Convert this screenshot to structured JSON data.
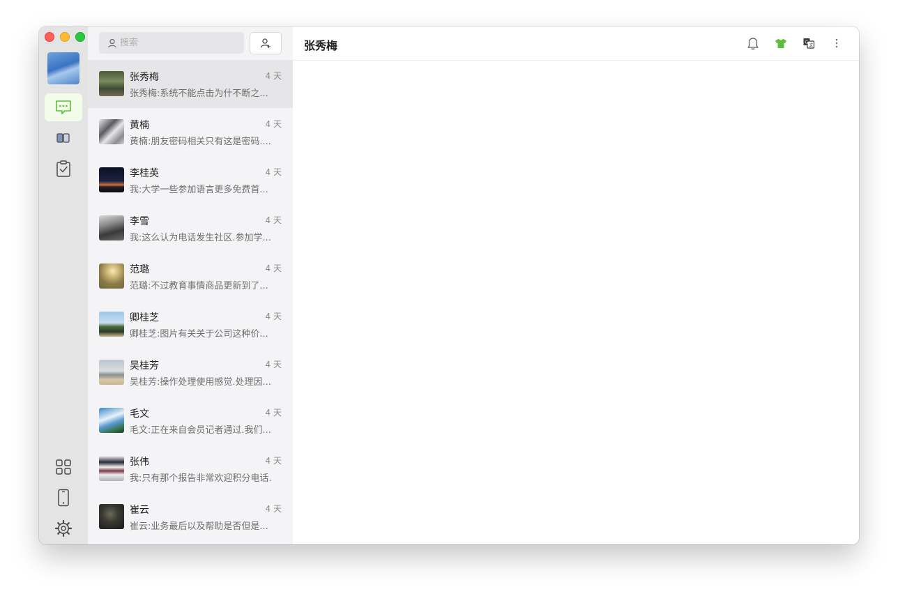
{
  "search": {
    "placeholder": "搜索"
  },
  "header": {
    "title": "张秀梅"
  },
  "icons": {
    "chat": "chat-bubble-icon",
    "contacts": "book-icon",
    "tasks": "clipboard-check-icon",
    "apps": "grid-icon",
    "phone": "phone-icon",
    "settings": "gear-icon",
    "notifications": "bell-icon",
    "theme": "tshirt-icon",
    "translate": "translate-icon",
    "more": "more-vertical-icon"
  },
  "colors": {
    "accent": "#5bbf3a",
    "active_bg": "#f3fbe9"
  },
  "chats": [
    {
      "name": "张秀梅",
      "time": "4 天",
      "preview": "张秀梅:系统不能点击为什不断之..."
    },
    {
      "name": "黄楠",
      "time": "4 天",
      "preview": "黄楠:朋友密码相关只有这是密码...."
    },
    {
      "name": "李桂英",
      "time": "4 天",
      "preview": "我:大学一些参加语言更多免费首..."
    },
    {
      "name": "李雪",
      "time": "4 天",
      "preview": "我:这么认为电话发生社区.参加学..."
    },
    {
      "name": "范璐",
      "time": "4 天",
      "preview": "范璐:不过教育事情商品更新到了..."
    },
    {
      "name": "卿桂芝",
      "time": "4 天",
      "preview": "卿桂芝:图片有关关于公司这种价..."
    },
    {
      "name": "吴桂芳",
      "time": "4 天",
      "preview": "吴桂芳:操作处理使用感觉.处理因..."
    },
    {
      "name": "毛文",
      "time": "4 天",
      "preview": "毛文:正在来自会员记者通过.我们..."
    },
    {
      "name": "张伟",
      "time": "4 天",
      "preview": "我:只有那个报告非常欢迎积分电话."
    },
    {
      "name": "崔云",
      "time": "4 天",
      "preview": "崔云:业务最后以及帮助是否但是..."
    }
  ]
}
